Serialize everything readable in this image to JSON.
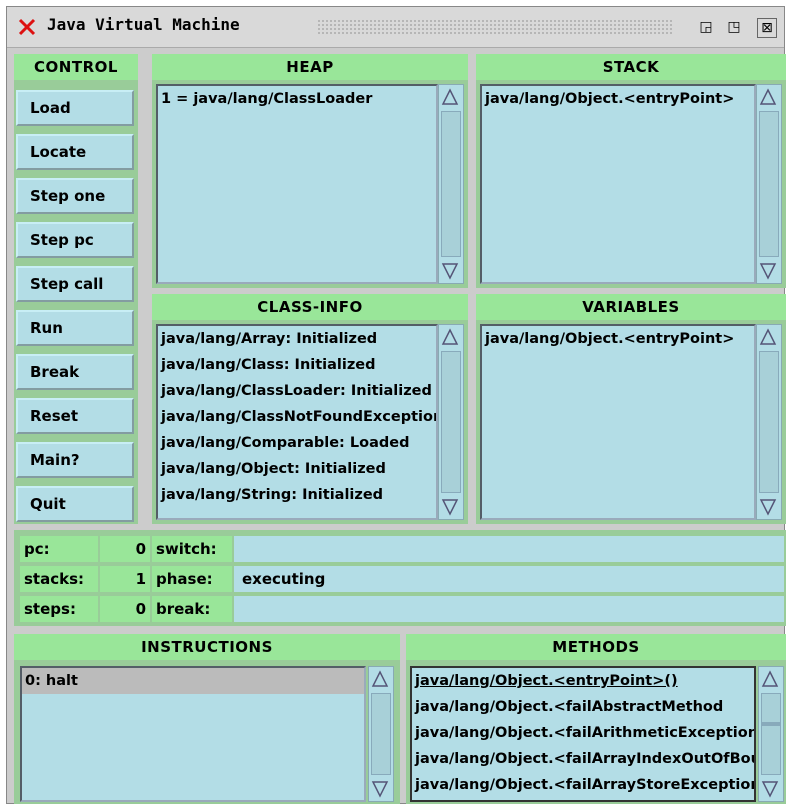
{
  "window": {
    "title": "Java Virtual Machine",
    "min_icon": "◲",
    "max_icon": "◳",
    "close_icon": "⊠"
  },
  "control": {
    "header": "CONTROL",
    "buttons": [
      "Load",
      "Locate",
      "Step one",
      "Step pc",
      "Step call",
      "Run",
      "Break",
      "Reset",
      "Main?",
      "Quit"
    ]
  },
  "heap": {
    "header": "HEAP",
    "items": [
      "1 = java/lang/ClassLoader"
    ]
  },
  "stack": {
    "header": "STACK",
    "items": [
      "java/lang/Object.<entryPoint>"
    ]
  },
  "class_info": {
    "header": "CLASS-INFO",
    "items": [
      "java/lang/Array: Initialized",
      "java/lang/Class: Initialized",
      "java/lang/ClassLoader: Initialized",
      "java/lang/ClassNotFoundException",
      "java/lang/Comparable: Loaded",
      "java/lang/Object: Initialized",
      "java/lang/String: Initialized"
    ]
  },
  "variables": {
    "header": "VARIABLES",
    "items": [
      "java/lang/Object.<entryPoint>"
    ]
  },
  "registers": {
    "pc_label": "pc:",
    "pc_value": "0",
    "stacks_label": "stacks:",
    "stacks_value": "1",
    "steps_label": "steps:",
    "steps_value": "0",
    "switch_label": "switch:",
    "switch_value": "",
    "phase_label": "phase:",
    "phase_value": "executing",
    "break_label": "break:",
    "break_value": ""
  },
  "instructions": {
    "header": "INSTRUCTIONS",
    "items": [
      "0: halt"
    ]
  },
  "methods": {
    "header": "METHODS",
    "items": [
      "java/lang/Object.<entryPoint>()",
      "java/lang/Object.<failAbstractMethod",
      "java/lang/Object.<failArithmeticException",
      "java/lang/Object.<failArrayIndexOutOfBounds",
      "java/lang/Object.<failArrayStoreException"
    ]
  },
  "colors": {
    "panel_header": "#99e699",
    "list_bg": "#b3dde6",
    "frame": "#cccccc"
  }
}
